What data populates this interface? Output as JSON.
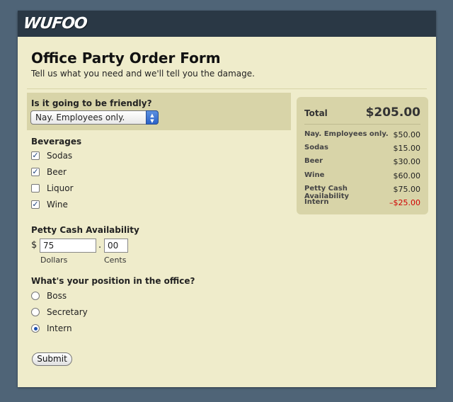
{
  "header": {
    "logo": "WUFOO"
  },
  "form": {
    "title": "Office Party Order Form",
    "subtitle": "Tell us what you need and we'll tell you the damage.",
    "friendly": {
      "label": "Is it going to be friendly?",
      "selected": "Nay. Employees only."
    },
    "beverages": {
      "label": "Beverages",
      "items": [
        {
          "label": "Sodas",
          "checked": true
        },
        {
          "label": "Beer",
          "checked": true
        },
        {
          "label": "Liquor",
          "checked": false
        },
        {
          "label": "Wine",
          "checked": true
        }
      ]
    },
    "petty_cash": {
      "label": "Petty Cash Availability",
      "currency_symbol": "$",
      "dollars_value": "75",
      "cents_value": "00",
      "separator": ".",
      "dollars_label": "Dollars",
      "cents_label": "Cents"
    },
    "position": {
      "label": "What's your position in the office?",
      "options": [
        {
          "label": "Boss",
          "selected": false
        },
        {
          "label": "Secretary",
          "selected": false
        },
        {
          "label": "Intern",
          "selected": true
        }
      ]
    },
    "submit_label": "Submit"
  },
  "summary": {
    "total_label": "Total",
    "total_value": "$205.00",
    "items": [
      {
        "label": "Nay. Employees only.",
        "amount": "$50.00",
        "negative": false
      },
      {
        "label": "Sodas",
        "amount": "$15.00",
        "negative": false
      },
      {
        "label": "Beer",
        "amount": "$30.00",
        "negative": false
      },
      {
        "label": "Wine",
        "amount": "$60.00",
        "negative": false
      },
      {
        "label": "Petty Cash Availability",
        "amount": "$75.00",
        "negative": false
      },
      {
        "label": "Intern",
        "amount": "–$25.00",
        "negative": true
      }
    ]
  },
  "colors": {
    "background": "#4f6477",
    "header": "#2a3845",
    "form_bg": "#efeccb",
    "panel_bg": "#d8d4a8",
    "negative": "#d00000"
  }
}
